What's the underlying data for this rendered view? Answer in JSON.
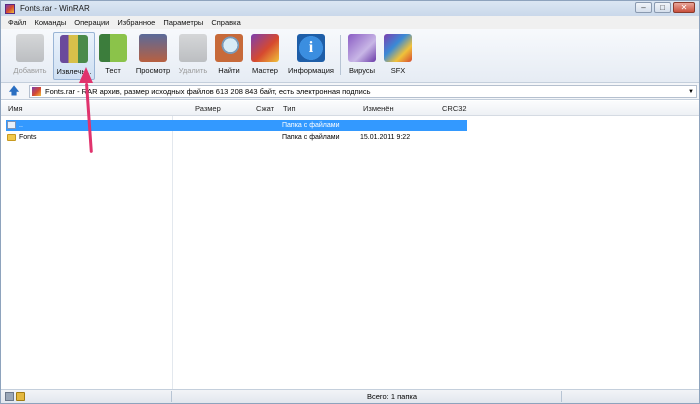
{
  "window": {
    "title": "Fonts.rar - WinRAR"
  },
  "menu": [
    "Файл",
    "Команды",
    "Операции",
    "Избранное",
    "Параметры",
    "Справка"
  ],
  "toolbar": {
    "add": "Добавить",
    "extract": "Извлечь...",
    "test": "Тест",
    "view": "Просмотр",
    "delete": "Удалить",
    "find": "Найти",
    "wizard": "Мастер",
    "info": "Информация",
    "virus": "Вирусы",
    "sfx": "SFX"
  },
  "address": {
    "text": "Fonts.rar - RAR архив, размер исходных файлов 613 208 843 байт, есть электронная подпись"
  },
  "columns": {
    "name": "Имя",
    "size": "Размер",
    "packed": "Сжат",
    "type": "Тип",
    "modified": "Изменён",
    "crc": "CRC32"
  },
  "rows": [
    {
      "name": "..",
      "type": "Папка с файлами",
      "modified": ""
    },
    {
      "name": "Fonts",
      "type": "Папка с файлами",
      "modified": "15.01.2011 9:22"
    }
  ],
  "status": {
    "text": "Всего: 1 папка"
  },
  "colors": {
    "selection": "#3399ff",
    "annotation_arrow": "#e0336d"
  },
  "icons": [
    "up-arrow-icon",
    "archive-icon",
    "folder-icon",
    "lock-icon",
    "disk-icon"
  ]
}
